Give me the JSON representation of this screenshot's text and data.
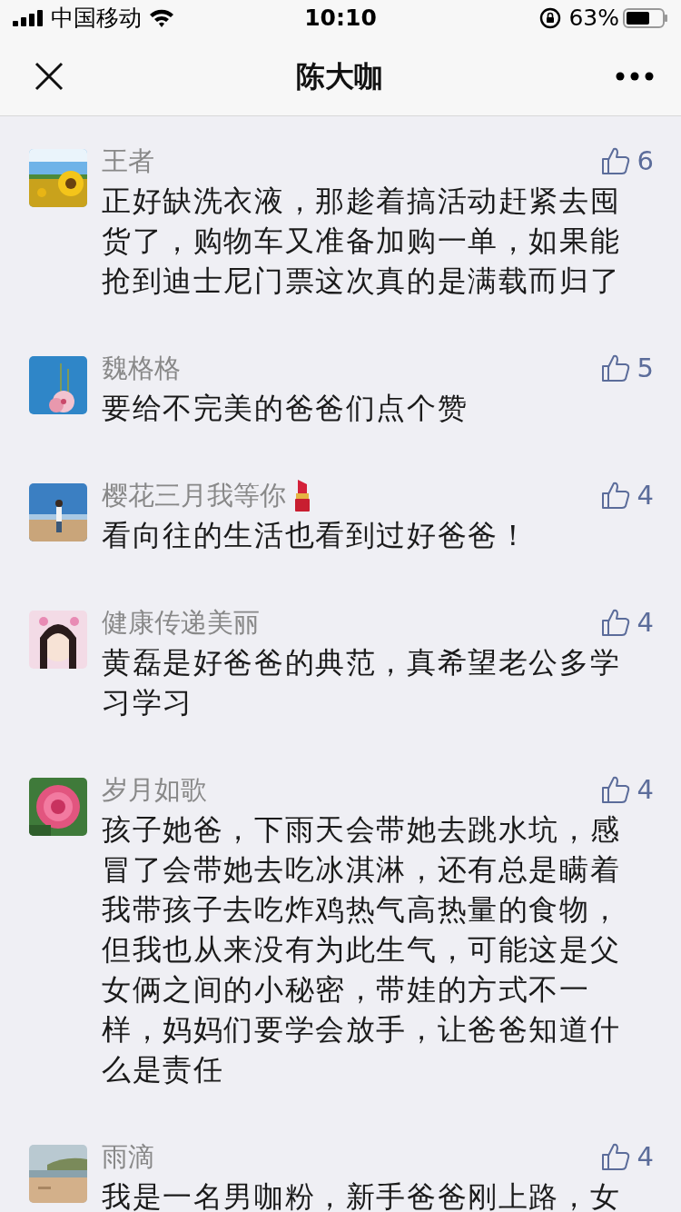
{
  "status_bar": {
    "carrier": "中国移动",
    "time": "10:10",
    "battery": "63%"
  },
  "nav": {
    "title": "陈大咖"
  },
  "comments": [
    {
      "name": "王者",
      "lipstick_icon": false,
      "likes": "6",
      "text": "正好缺洗衣液，那趁着搞活动赶紧去囤货了，购物车又准备加购一单，如果能抢到迪士尼门票这次真的是满载而归了"
    },
    {
      "name": "魏格格",
      "lipstick_icon": false,
      "likes": "5",
      "text": "要给不完美的爸爸们点个赞"
    },
    {
      "name": "樱花三月我等你",
      "lipstick_icon": true,
      "likes": "4",
      "text": "看向往的生活也看到过好爸爸！"
    },
    {
      "name": "健康传递美丽",
      "lipstick_icon": false,
      "likes": "4",
      "text": "黄磊是好爸爸的典范，真希望老公多学习学习"
    },
    {
      "name": "岁月如歌",
      "lipstick_icon": false,
      "likes": "4",
      "text": "孩子她爸，下雨天会带她去跳水坑，感冒了会带她去吃冰淇淋，还有总是瞒着我带孩子去吃炸鸡热气高热量的食物，但我也从来没有为此生气，可能这是父女俩之间的小秘密，带娃的方式不一样，妈妈们要学会放手，让爸爸知道什么是责任"
    },
    {
      "name": "雨滴",
      "lipstick_icon": false,
      "likes": "4",
      "text": "我是一名男咖粉，新手爸爸刚上路，女"
    }
  ]
}
